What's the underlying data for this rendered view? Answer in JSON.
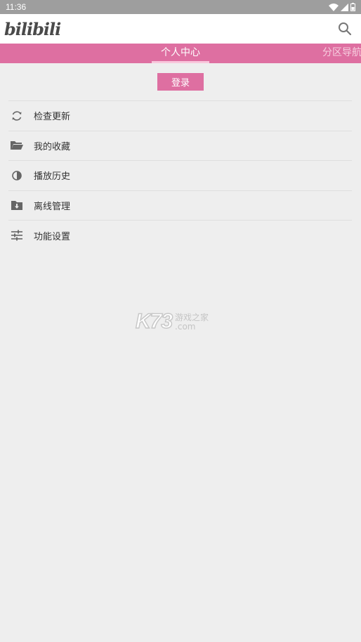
{
  "status_bar": {
    "time": "11:36"
  },
  "app_bar": {
    "logo_text": "bilibili",
    "search_icon": "search-icon"
  },
  "tabs": [
    {
      "label": "个人中心",
      "active": true
    },
    {
      "label": "分区导航",
      "active": false
    }
  ],
  "login_button": {
    "label": "登录"
  },
  "menu": {
    "items": [
      {
        "label": "检查更新",
        "icon": "refresh-icon"
      },
      {
        "label": "我的收藏",
        "icon": "folder-icon"
      },
      {
        "label": "播放历史",
        "icon": "history-icon"
      },
      {
        "label": "离线管理",
        "icon": "download-folder-icon"
      },
      {
        "label": "功能设置",
        "icon": "settings-sliders-icon"
      }
    ]
  },
  "watermark": {
    "main": "K73",
    "cn": "游戏之家",
    "domain": ".com"
  },
  "colors": {
    "accent": "#de6fa1",
    "status_bar": "#9e9e9e",
    "background": "#eeeeee"
  }
}
